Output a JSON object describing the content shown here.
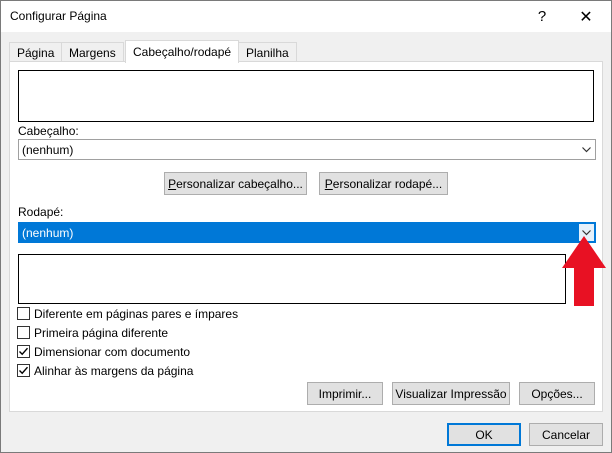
{
  "window": {
    "title": "Configurar Página",
    "help_glyph": "?",
    "close_glyph": "✕"
  },
  "tabs": [
    {
      "label": "Página"
    },
    {
      "label": "Margens"
    },
    {
      "label": "Cabeçalho/rodapé"
    },
    {
      "label": "Planilha"
    }
  ],
  "active_tab": "Cabeçalho/rodapé",
  "header": {
    "label": "Cabeçalho:",
    "value": "(nenhum)",
    "customize_button": "Personalizar cabeçalho...",
    "customize_button_mnemonic": "P",
    "customize_button_rest": "ersonalizar cabeçalho..."
  },
  "footer": {
    "label": "Rodapé:",
    "value": "(nenhum)",
    "customize_button": "Personalizar rodapé...",
    "customize_button_mnemonic": "P",
    "customize_button_rest": "ersonalizar rodapé..."
  },
  "options": [
    {
      "label": "Diferente em páginas pares e ímpares",
      "checked": false
    },
    {
      "label": "Primeira página diferente",
      "checked": false
    },
    {
      "label": "Dimensionar com documento",
      "checked": true
    },
    {
      "label": "Alinhar às margens da página",
      "checked": true
    }
  ],
  "actions": {
    "print": "Imprimir...",
    "print_preview": "Visualizar Impressão",
    "options": "Opções..."
  },
  "footer_buttons": {
    "ok": "OK",
    "cancel": "Cancelar"
  },
  "colors": {
    "accent": "#0078d7",
    "annotation_arrow": "#e81123"
  }
}
